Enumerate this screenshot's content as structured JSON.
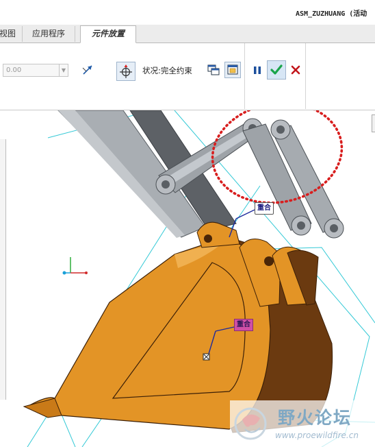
{
  "window": {
    "title": "ASM_ZUZHUANG (活动"
  },
  "tabs": [
    {
      "label": "视图"
    },
    {
      "label": "应用程序"
    },
    {
      "label": "元件放置"
    }
  ],
  "ribbon": {
    "offset_value": "0.00",
    "status_text": "状况:完全约束"
  },
  "viewport": {
    "markers": [
      {
        "label": "重合"
      },
      {
        "label": "重合"
      }
    ]
  },
  "watermark": {
    "name": "野火论坛",
    "url": "www.proewildfire.cn"
  },
  "colors": {
    "bucket": "#e39426",
    "arm": "#a9aeb3",
    "datum_plane": "#33c9d6",
    "annotation_red": "#d81e1e",
    "accept_green": "#1aa44a",
    "cancel_red": "#c2151b",
    "pause_blue": "#1c4f9c"
  },
  "icons": [
    "flip-arrow-icon",
    "move-component-icon",
    "separate-window-icon",
    "current-window-icon",
    "pause-icon",
    "check-icon",
    "cancel-icon",
    "coordinate-axes-icon",
    "watermark-logo-icon"
  ]
}
